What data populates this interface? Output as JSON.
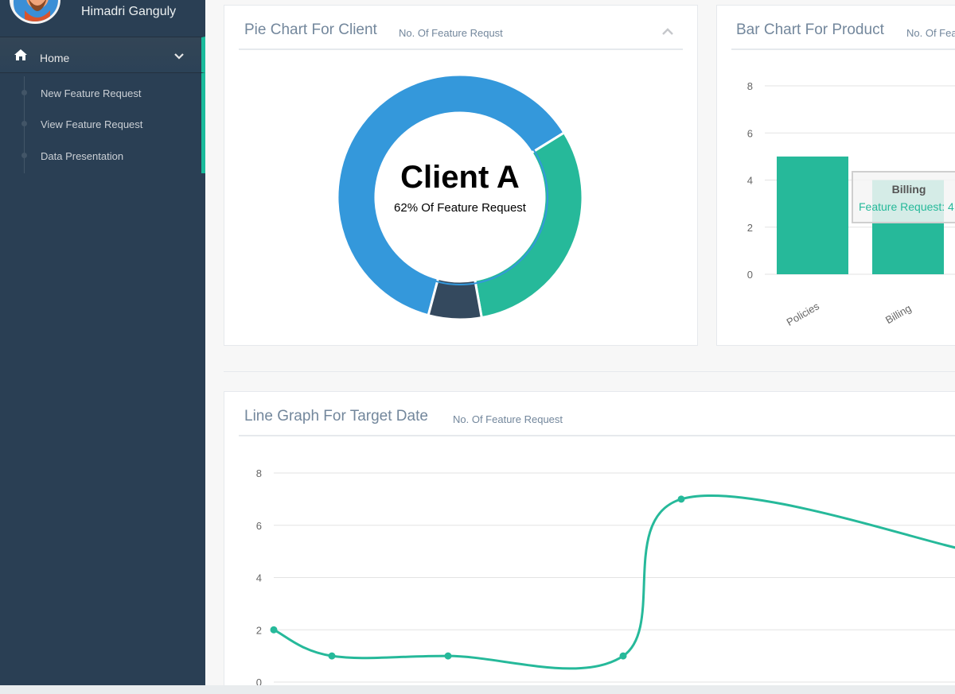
{
  "sidebar": {
    "user_name": "Himadri Ganguly",
    "home": {
      "label": "Home",
      "icon": "home-icon"
    },
    "items": [
      {
        "label": "New Feature Request"
      },
      {
        "label": "View Feature Request"
      },
      {
        "label": "Data Presentation"
      }
    ],
    "accent_color": "#1abb9c",
    "bg_color": "#2a3f54"
  },
  "pie_panel": {
    "title": "Pie Chart For Client",
    "subtitle": "No. Of Feature Requst",
    "center_title": "Client A",
    "center_text": "62% Of Feature Request"
  },
  "bar_panel": {
    "title": "Bar Chart For Product",
    "subtitle": "No. Of Fea",
    "tooltip_title": "Billing",
    "tooltip_text": "Feature Request: 4"
  },
  "line_panel": {
    "title": "Line Graph For Target Date",
    "subtitle": "No. Of Feature Request"
  },
  "chart_data": [
    {
      "type": "pie",
      "title": "Pie Chart For Client",
      "slices": [
        {
          "label": "Client A",
          "percent": 62,
          "color": "#3498db"
        },
        {
          "percent": 31,
          "color": "#26b99a"
        },
        {
          "percent": 7,
          "color": "#34495e"
        }
      ]
    },
    {
      "type": "bar",
      "title": "Bar Chart For Product",
      "categories": [
        "Policies",
        "Billing"
      ],
      "values": [
        5,
        4
      ],
      "ylim": [
        0,
        8
      ],
      "yticks": [
        "0",
        "2",
        "4",
        "6",
        "8"
      ],
      "grid": true,
      "color": "#26b99a"
    },
    {
      "type": "line",
      "title": "Line Graph For Target Date",
      "values": [
        2,
        1,
        1,
        1,
        7,
        5
      ],
      "ylim": [
        0,
        8
      ],
      "yticks": [
        "0",
        "2",
        "4",
        "6",
        "8"
      ],
      "grid": true,
      "color": "#26b99a"
    }
  ]
}
